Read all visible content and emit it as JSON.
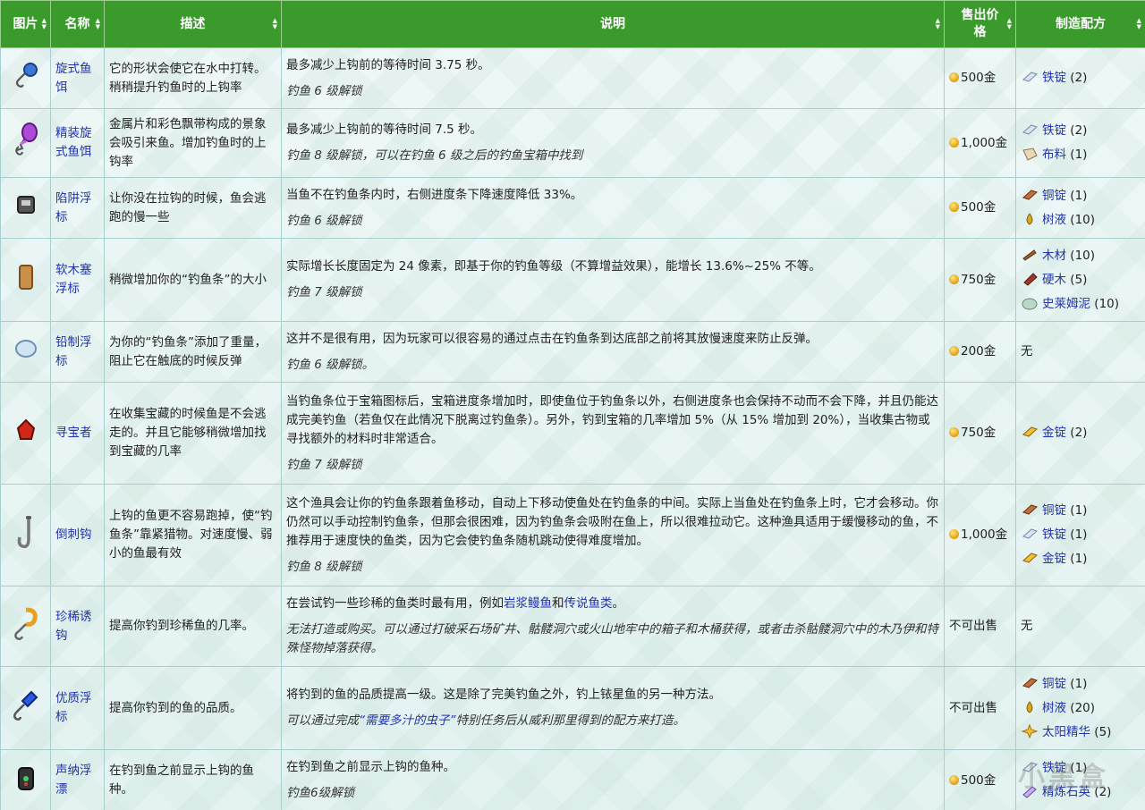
{
  "headers": [
    "图片",
    "名称",
    "描述",
    "说明",
    "售出价格",
    "制造配方"
  ],
  "rows": [
    {
      "name": "旋式鱼饵",
      "desc": "它的形状会使它在水中打转。稍稍提升钓鱼时的上钩率",
      "detail": "最多减少上钩前的等待时间 3.75 秒。",
      "note": "钓鱼 6 级解锁",
      "price": "500金",
      "icon": "spinner-icon",
      "ingredients": [
        {
          "name": "铁锭",
          "qty": "(2)",
          "icon": "iron-bar-icon"
        }
      ]
    },
    {
      "name": "精装旋式鱼饵",
      "desc": "金属片和彩色飘带构成的景象会吸引来鱼。增加钓鱼时的上钩率",
      "detail": "最多减少上钩前的等待时间 7.5 秒。",
      "note": "钓鱼 8 级解锁，可以在钓鱼 6 级之后的钓鱼宝箱中找到",
      "price": "1,000金",
      "icon": "dressed-spinner-icon",
      "ingredients": [
        {
          "name": "铁锭",
          "qty": "(2)",
          "icon": "iron-bar-icon"
        },
        {
          "name": "布料",
          "qty": "(1)",
          "icon": "cloth-icon"
        }
      ]
    },
    {
      "name": "陷阱浮标",
      "desc": "让你没在拉钩的时候，鱼会逃跑的慢一些",
      "detail": "当鱼不在钓鱼条内时，右侧进度条下降速度降低 33%。",
      "note": "钓鱼 6 级解锁",
      "price": "500金",
      "icon": "trap-bobber-icon",
      "ingredients": [
        {
          "name": "铜锭",
          "qty": "(1)",
          "icon": "copper-bar-icon"
        },
        {
          "name": "树液",
          "qty": "(10)",
          "icon": "sap-icon"
        }
      ]
    },
    {
      "name": "软木塞浮标",
      "desc": "稍微增加你的“钓鱼条”的大小",
      "detail": "实际增长长度固定为 24 像素，即基于你的钓鱼等级（不算增益效果），能增长 13.6%~25% 不等。",
      "note": "钓鱼 7 级解锁",
      "price": "750金",
      "icon": "cork-bobber-icon",
      "ingredients": [
        {
          "name": "木材",
          "qty": "(10)",
          "icon": "wood-icon"
        },
        {
          "name": "硬木",
          "qty": "(5)",
          "icon": "hardwood-icon"
        },
        {
          "name": "史莱姆泥",
          "qty": "(10)",
          "icon": "slime-icon"
        }
      ]
    },
    {
      "name": "铅制浮标",
      "desc": "为你的“钓鱼条”添加了重量，阻止它在触底的时候反弹",
      "detail": "这并不是很有用，因为玩家可以很容易的通过点击在钓鱼条到达底部之前将其放慢速度来防止反弹。",
      "note": "钓鱼 6 级解锁。",
      "price": "200金",
      "icon": "lead-bobber-icon",
      "ingredients": [],
      "none": "无"
    },
    {
      "name": "寻宝者",
      "desc": "在收集宝藏的时候鱼是不会逃走的。并且它能够稍微增加找到宝藏的几率",
      "detail": "当钓鱼条位于宝箱图标后，宝箱进度条增加时，即使鱼位于钓鱼条以外，右侧进度条也会保持不动而不会下降，并且仍能达成完美钓鱼（若鱼仅在此情况下脱离过钓鱼条）。另外，钓到宝箱的几率增加 5%（从 15% 增加到 20%），当收集古物或寻找额外的材料时非常适合。",
      "note": "钓鱼 7 级解锁",
      "price": "750金",
      "icon": "treasure-hunter-icon",
      "ingredients": [
        {
          "name": "金锭",
          "qty": "(2)",
          "icon": "gold-bar-icon"
        }
      ]
    },
    {
      "name": "倒刺钩",
      "desc": "上钩的鱼更不容易跑掉，使“钓鱼条”靠紧猎物。对速度慢、弱小的鱼最有效",
      "detail": "这个渔具会让你的钓鱼条跟着鱼移动，自动上下移动使鱼处在钓鱼条的中间。实际上当鱼处在钓鱼条上时，它才会移动。你仍然可以手动控制钓鱼条，但那会很困难，因为钓鱼条会吸附在鱼上，所以很难拉动它。这种渔具适用于缓慢移动的鱼，不推荐用于速度快的鱼类，因为它会使钓鱼条随机跳动使得难度增加。",
      "note": "钓鱼 8 级解锁",
      "price": "1,000金",
      "icon": "barbed-hook-icon",
      "ingredients": [
        {
          "name": "铜锭",
          "qty": "(1)",
          "icon": "copper-bar-icon"
        },
        {
          "name": "铁锭",
          "qty": "(1)",
          "icon": "iron-bar-icon"
        },
        {
          "name": "金锭",
          "qty": "(1)",
          "icon": "gold-bar-icon"
        }
      ]
    },
    {
      "name": "珍稀诱钩",
      "desc": "提高你钓到珍稀鱼的几率。",
      "detail_a": "在尝试钓一些珍稀的鱼类时最有用，例如",
      "link1": "岩浆鳗鱼",
      "detail_b": "和",
      "link2": "传说鱼类",
      "detail_c": "。",
      "note": "无法打造或购买。可以通过打破采石场矿井、骷髅洞穴或火山地牢中的箱子和木桶获得，或者击杀骷髅洞穴中的木乃伊和特殊怪物掉落获得。",
      "price": "不可出售",
      "icon": "curiosity-lure-icon",
      "ingredients": [],
      "none": "无"
    },
    {
      "name": "优质浮标",
      "desc": "提高你钓到的鱼的品质。",
      "detail": "将钓到的鱼的品质提高一级。这是除了完美钓鱼之外，钓上铱星鱼的另一种方法。",
      "note_a": "可以通过完成",
      "note_link": "“需要多汁的虫子”",
      "note_b": "特别任务后从威利那里得到的配方来打造。",
      "price": "不可出售",
      "icon": "quality-bobber-icon",
      "ingredients": [
        {
          "name": "铜锭",
          "qty": "(1)",
          "icon": "copper-bar-icon"
        },
        {
          "name": "树液",
          "qty": "(20)",
          "icon": "sap-icon"
        },
        {
          "name": "太阳精华",
          "qty": "(5)",
          "icon": "solar-essence-icon"
        }
      ]
    },
    {
      "name": "声纳浮漂",
      "desc": "在钓到鱼之前显示上钩的鱼种。",
      "detail": "在钓到鱼之前显示上钩的鱼种。",
      "note": "钓鱼6级解锁",
      "price": "500金",
      "icon": "sonar-bobber-icon",
      "ingredients": [
        {
          "name": "铁锭",
          "qty": "(1)",
          "icon": "iron-bar-icon"
        },
        {
          "name": "精炼石英",
          "qty": "(2)",
          "icon": "refined-quartz-icon"
        }
      ]
    }
  ],
  "watermark": "小黑盒"
}
